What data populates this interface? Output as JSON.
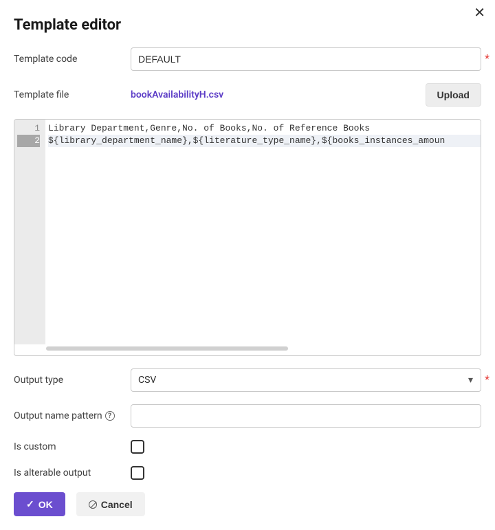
{
  "dialog": {
    "title": "Template editor",
    "close_glyph": "✕"
  },
  "fields": {
    "template_code": {
      "label": "Template code",
      "value": "DEFAULT",
      "required": true
    },
    "template_file": {
      "label": "Template file",
      "filename": "bookAvailabilityH.csv",
      "upload_label": "Upload"
    },
    "output_type": {
      "label": "Output type",
      "value": "CSV",
      "required": true
    },
    "output_name_pattern": {
      "label": "Output name pattern",
      "value": ""
    },
    "is_custom": {
      "label": "Is custom",
      "checked": false
    },
    "is_alterable_output": {
      "label": "Is alterable output",
      "checked": false
    }
  },
  "code_editor": {
    "lines": [
      "Library Department,Genre,No. of Books,No. of Reference Books",
      "${library_department_name},${literature_type_name},${books_instances_amoun"
    ],
    "active_line": 2
  },
  "actions": {
    "ok": "OK",
    "cancel": "Cancel"
  }
}
